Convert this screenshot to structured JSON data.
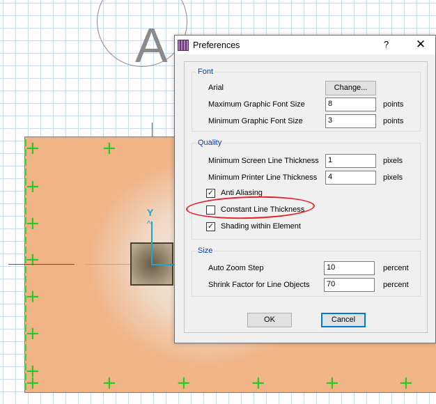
{
  "canvas": {
    "big_letter": "A",
    "axis_label": "Y"
  },
  "dialog": {
    "title": "Preferences",
    "help_glyph": "?",
    "close_glyph": "✕",
    "font_group": {
      "title": "Font",
      "font_name": "Arial",
      "change_button": "Change...",
      "max_label": "Maximum Graphic Font Size",
      "max_value": "8",
      "max_unit": "points",
      "min_label": "Minimum Graphic Font Size",
      "min_value": "3",
      "min_unit": "points"
    },
    "quality_group": {
      "title": "Quality",
      "screen_label": "Minimum Screen Line Thickness",
      "screen_value": "1",
      "screen_unit": "pixels",
      "printer_label": "Minimum Printer Line Thickness",
      "printer_value": "4",
      "printer_unit": "pixels",
      "anti_aliasing_label": "Anti Aliasing",
      "anti_aliasing_checked": true,
      "constant_label": "Constant Line Thickness",
      "constant_checked": false,
      "shading_label": "Shading within Element",
      "shading_checked": true
    },
    "size_group": {
      "title": "Size",
      "zoom_label": "Auto Zoom Step",
      "zoom_value": "10",
      "zoom_unit": "percent",
      "shrink_label": "Shrink Factor for Line Objects",
      "shrink_value": "70",
      "shrink_unit": "percent"
    },
    "ok_button": "OK",
    "cancel_button": "Cancel"
  },
  "colors": {
    "group_title": "#0b3ba8",
    "annotation": "#e81e2a",
    "axis": "#1ca7c9",
    "element_fill": "#f0b487",
    "grid": "#c9dcef"
  }
}
